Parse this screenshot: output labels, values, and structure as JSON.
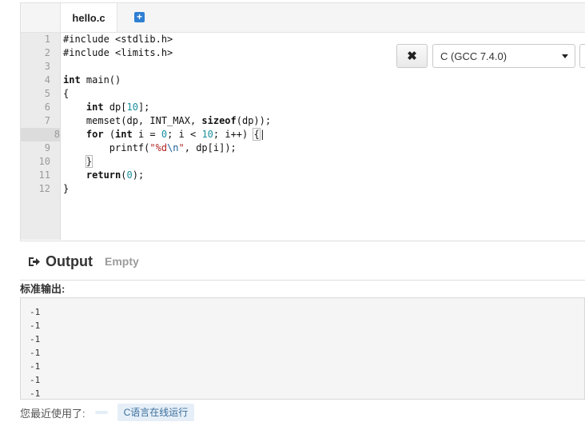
{
  "editor": {
    "tab_label": "hello.c",
    "add_tab_icon": "plus-square-icon",
    "active_line": 8,
    "line_numbers": [
      "1",
      "2",
      "3",
      "4",
      "5",
      "6",
      "7",
      "8",
      "9",
      "10",
      "11",
      "12"
    ]
  },
  "controls": {
    "clear_icon": "close-icon",
    "clear_glyph": "✖",
    "language_selected": "C (GCC 7.4.0)"
  },
  "output": {
    "title": "Output",
    "status": "Empty",
    "icon": "sign-out-icon",
    "stdout_label": "标准输出:",
    "stdout_lines": [
      "-1",
      "-1",
      "-1",
      "-1",
      "-1",
      "-1",
      "-1"
    ]
  },
  "recent": {
    "label": "您最近使用了:",
    "tag": "C语言在线运行"
  },
  "colors": {
    "accent": "#2f7fd3",
    "gutter_bg": "#ebebeb",
    "stdout_bg": "#f5f5f5",
    "tag_bg": "#e6eff8"
  }
}
